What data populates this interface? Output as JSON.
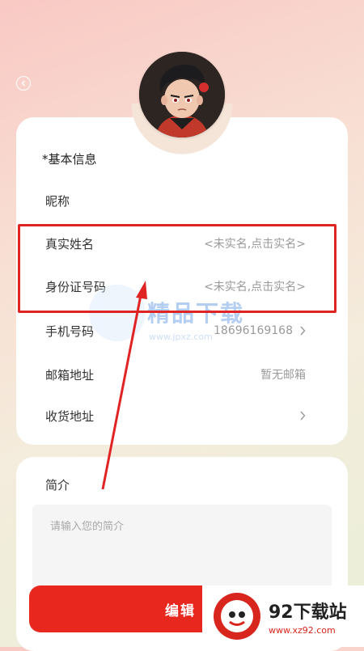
{
  "profile": {
    "section_title": "*基本信息",
    "rows": [
      {
        "label": "昵称",
        "value": ""
      },
      {
        "label": "真实姓名",
        "value": "<未实名,点击实名>"
      },
      {
        "label": "身份证号码",
        "value": "<未实名,点击实名>"
      },
      {
        "label": "手机号码",
        "value": "18696169168"
      },
      {
        "label": "邮箱地址",
        "value": "暂无邮箱"
      },
      {
        "label": "收货地址",
        "value": ""
      }
    ]
  },
  "intro": {
    "title": "简介",
    "placeholder": "请输入您的简介"
  },
  "edit_button": {
    "label": "编辑"
  },
  "watermark": {
    "text": "精品下载",
    "url": "www.jpxz.com"
  },
  "logo": {
    "name": "92下载站",
    "url": "www.xz92.com"
  },
  "colors": {
    "accent": "#e8271f",
    "highlight": "#e02424",
    "watermark": "#2a74d8"
  },
  "icons": [
    "back-icon",
    "chevron-right-icon",
    "avatar-image",
    "xz92-logo-icon"
  ]
}
